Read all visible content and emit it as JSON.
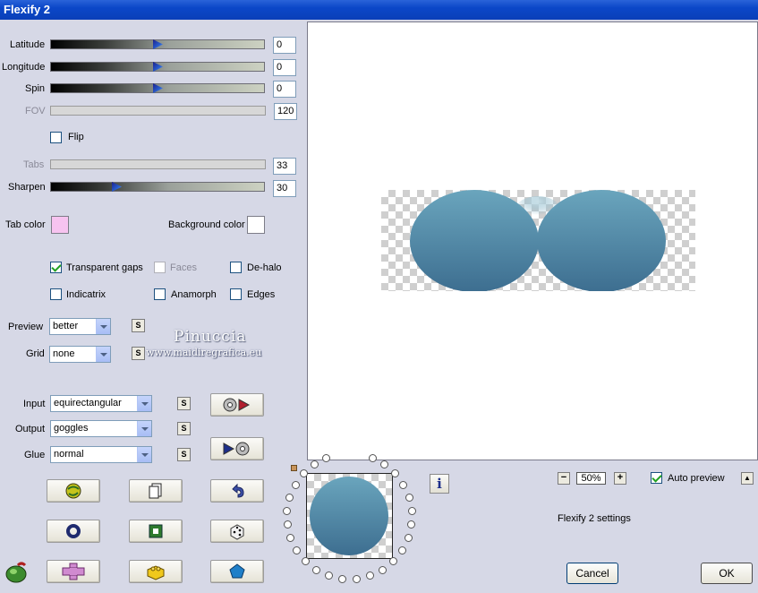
{
  "window": {
    "title": "Flexify 2"
  },
  "sliders": [
    {
      "key": "latitude",
      "label": "Latitude",
      "value": "0",
      "level": 0.5,
      "enabled": true
    },
    {
      "key": "longitude",
      "label": "Longitude",
      "value": "0",
      "level": 0.5,
      "enabled": true
    },
    {
      "key": "spin",
      "label": "Spin",
      "value": "0",
      "level": 0.5,
      "enabled": true
    },
    {
      "key": "fov",
      "label": "FOV",
      "value": "120",
      "level": null,
      "enabled": false
    },
    {
      "key": "tabs",
      "label": "Tabs",
      "value": "33",
      "level": null,
      "enabled": false
    },
    {
      "key": "sharpen",
      "label": "Sharpen",
      "value": "30",
      "level": 0.3,
      "enabled": true
    }
  ],
  "flip": {
    "label": "Flip",
    "checked": false
  },
  "colors": {
    "tab_color_label": "Tab color",
    "tab_color": "#f7c3f0",
    "background_color_label": "Background color",
    "background_color": "#ffffff"
  },
  "options": {
    "transparent_gaps": "Transparent gaps",
    "faces": "Faces",
    "de_halo": "De-halo",
    "indicatrix": "Indicatrix",
    "anamorph": "Anamorph",
    "edges": "Edges"
  },
  "dropdowns": {
    "preview": {
      "label": "Preview",
      "value": "better"
    },
    "grid": {
      "label": "Grid",
      "value": "none"
    },
    "input": {
      "label": "Input",
      "value": "equirectangular"
    },
    "output": {
      "label": "Output",
      "value": "goggles"
    },
    "glue": {
      "label": "Glue",
      "value": "normal"
    }
  },
  "s_label": "S",
  "watermark": {
    "name": "Pinuccia",
    "site": "www.maidiregrafica.eu"
  },
  "zoom": {
    "value": "50%",
    "minus": "−",
    "plus": "+"
  },
  "auto_preview": {
    "label": "Auto preview",
    "checked": true
  },
  "settings_text": "Flexify 2 settings",
  "info_label": "i",
  "buttons": {
    "cancel": "Cancel",
    "ok": "OK"
  },
  "theme": {
    "shape_color_top": "#6aa5bd",
    "shape_color_bottom": "#3d6e90",
    "accent": "#2a63d9"
  }
}
